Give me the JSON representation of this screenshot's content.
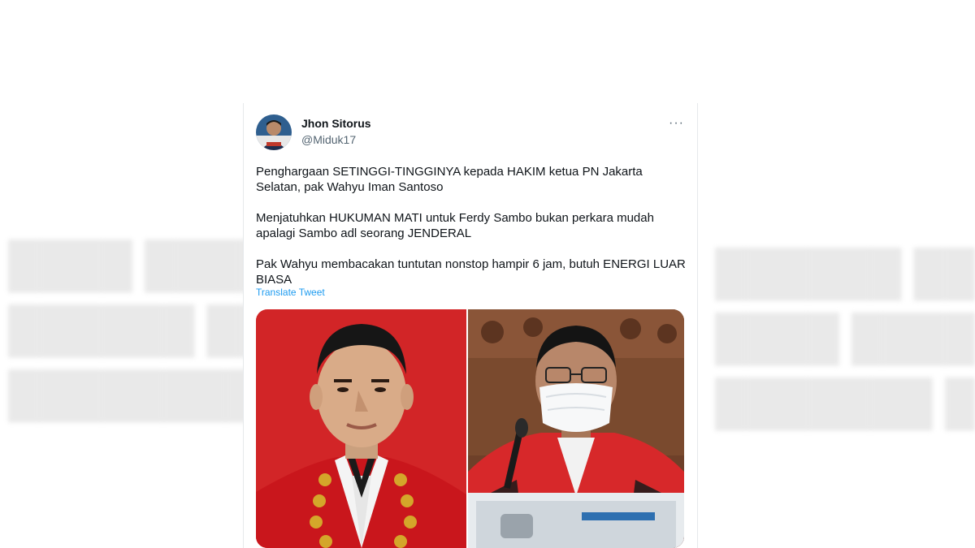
{
  "tweet": {
    "author_name": "Jhon Sitorus",
    "author_handle": "@Miduk17",
    "more_icon": "···",
    "paragraphs": [
      "Penghargaan SETINGGI-TINGGINYA kepada HAKIM ketua PN Jakarta Selatan, pak Wahyu Iman Santoso",
      "Menjatuhkan HUKUMAN MATI untuk Ferdy Sambo bukan perkara mudah apalagi Sambo adl seorang JENDERAL",
      "Pak Wahyu membacakan tuntutan nonstop hampir 6 jam, butuh ENERGI LUAR BIASA"
    ],
    "translate_label": "Translate Tweet"
  },
  "colors": {
    "text": "#0f1419",
    "muted": "#536471",
    "link": "#1d9bf0",
    "robe_red": "#d7282a",
    "courtroom_wood": "#7a4a2e"
  }
}
